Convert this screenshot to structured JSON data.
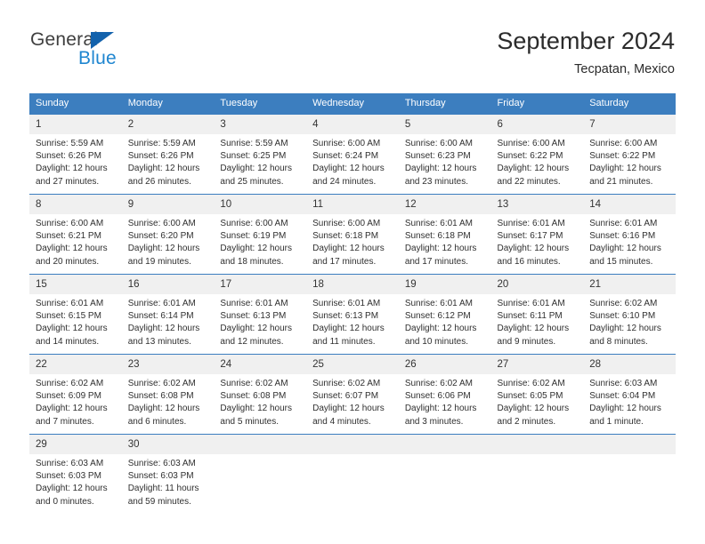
{
  "brand": {
    "name_top": "General",
    "name_bottom": "Blue",
    "accent_color": "#1f86d0",
    "triangle_color": "#1362ac"
  },
  "header": {
    "title": "September 2024",
    "subtitle": "Tecpatan, Mexico"
  },
  "theme": {
    "header_row_bg": "#3c7ebf",
    "daynum_bg": "#f0f0f0",
    "text_color": "#2f2f2f"
  },
  "weekday_headers": [
    "Sunday",
    "Monday",
    "Tuesday",
    "Wednesday",
    "Thursday",
    "Friday",
    "Saturday"
  ],
  "weeks": [
    [
      {
        "day": "1",
        "sunrise": "Sunrise: 5:59 AM",
        "sunset": "Sunset: 6:26 PM",
        "daylight_line1": "Daylight: 12 hours",
        "daylight_line2": "and 27 minutes."
      },
      {
        "day": "2",
        "sunrise": "Sunrise: 5:59 AM",
        "sunset": "Sunset: 6:26 PM",
        "daylight_line1": "Daylight: 12 hours",
        "daylight_line2": "and 26 minutes."
      },
      {
        "day": "3",
        "sunrise": "Sunrise: 5:59 AM",
        "sunset": "Sunset: 6:25 PM",
        "daylight_line1": "Daylight: 12 hours",
        "daylight_line2": "and 25 minutes."
      },
      {
        "day": "4",
        "sunrise": "Sunrise: 6:00 AM",
        "sunset": "Sunset: 6:24 PM",
        "daylight_line1": "Daylight: 12 hours",
        "daylight_line2": "and 24 minutes."
      },
      {
        "day": "5",
        "sunrise": "Sunrise: 6:00 AM",
        "sunset": "Sunset: 6:23 PM",
        "daylight_line1": "Daylight: 12 hours",
        "daylight_line2": "and 23 minutes."
      },
      {
        "day": "6",
        "sunrise": "Sunrise: 6:00 AM",
        "sunset": "Sunset: 6:22 PM",
        "daylight_line1": "Daylight: 12 hours",
        "daylight_line2": "and 22 minutes."
      },
      {
        "day": "7",
        "sunrise": "Sunrise: 6:00 AM",
        "sunset": "Sunset: 6:22 PM",
        "daylight_line1": "Daylight: 12 hours",
        "daylight_line2": "and 21 minutes."
      }
    ],
    [
      {
        "day": "8",
        "sunrise": "Sunrise: 6:00 AM",
        "sunset": "Sunset: 6:21 PM",
        "daylight_line1": "Daylight: 12 hours",
        "daylight_line2": "and 20 minutes."
      },
      {
        "day": "9",
        "sunrise": "Sunrise: 6:00 AM",
        "sunset": "Sunset: 6:20 PM",
        "daylight_line1": "Daylight: 12 hours",
        "daylight_line2": "and 19 minutes."
      },
      {
        "day": "10",
        "sunrise": "Sunrise: 6:00 AM",
        "sunset": "Sunset: 6:19 PM",
        "daylight_line1": "Daylight: 12 hours",
        "daylight_line2": "and 18 minutes."
      },
      {
        "day": "11",
        "sunrise": "Sunrise: 6:00 AM",
        "sunset": "Sunset: 6:18 PM",
        "daylight_line1": "Daylight: 12 hours",
        "daylight_line2": "and 17 minutes."
      },
      {
        "day": "12",
        "sunrise": "Sunrise: 6:01 AM",
        "sunset": "Sunset: 6:18 PM",
        "daylight_line1": "Daylight: 12 hours",
        "daylight_line2": "and 17 minutes."
      },
      {
        "day": "13",
        "sunrise": "Sunrise: 6:01 AM",
        "sunset": "Sunset: 6:17 PM",
        "daylight_line1": "Daylight: 12 hours",
        "daylight_line2": "and 16 minutes."
      },
      {
        "day": "14",
        "sunrise": "Sunrise: 6:01 AM",
        "sunset": "Sunset: 6:16 PM",
        "daylight_line1": "Daylight: 12 hours",
        "daylight_line2": "and 15 minutes."
      }
    ],
    [
      {
        "day": "15",
        "sunrise": "Sunrise: 6:01 AM",
        "sunset": "Sunset: 6:15 PM",
        "daylight_line1": "Daylight: 12 hours",
        "daylight_line2": "and 14 minutes."
      },
      {
        "day": "16",
        "sunrise": "Sunrise: 6:01 AM",
        "sunset": "Sunset: 6:14 PM",
        "daylight_line1": "Daylight: 12 hours",
        "daylight_line2": "and 13 minutes."
      },
      {
        "day": "17",
        "sunrise": "Sunrise: 6:01 AM",
        "sunset": "Sunset: 6:13 PM",
        "daylight_line1": "Daylight: 12 hours",
        "daylight_line2": "and 12 minutes."
      },
      {
        "day": "18",
        "sunrise": "Sunrise: 6:01 AM",
        "sunset": "Sunset: 6:13 PM",
        "daylight_line1": "Daylight: 12 hours",
        "daylight_line2": "and 11 minutes."
      },
      {
        "day": "19",
        "sunrise": "Sunrise: 6:01 AM",
        "sunset": "Sunset: 6:12 PM",
        "daylight_line1": "Daylight: 12 hours",
        "daylight_line2": "and 10 minutes."
      },
      {
        "day": "20",
        "sunrise": "Sunrise: 6:01 AM",
        "sunset": "Sunset: 6:11 PM",
        "daylight_line1": "Daylight: 12 hours",
        "daylight_line2": "and 9 minutes."
      },
      {
        "day": "21",
        "sunrise": "Sunrise: 6:02 AM",
        "sunset": "Sunset: 6:10 PM",
        "daylight_line1": "Daylight: 12 hours",
        "daylight_line2": "and 8 minutes."
      }
    ],
    [
      {
        "day": "22",
        "sunrise": "Sunrise: 6:02 AM",
        "sunset": "Sunset: 6:09 PM",
        "daylight_line1": "Daylight: 12 hours",
        "daylight_line2": "and 7 minutes."
      },
      {
        "day": "23",
        "sunrise": "Sunrise: 6:02 AM",
        "sunset": "Sunset: 6:08 PM",
        "daylight_line1": "Daylight: 12 hours",
        "daylight_line2": "and 6 minutes."
      },
      {
        "day": "24",
        "sunrise": "Sunrise: 6:02 AM",
        "sunset": "Sunset: 6:08 PM",
        "daylight_line1": "Daylight: 12 hours",
        "daylight_line2": "and 5 minutes."
      },
      {
        "day": "25",
        "sunrise": "Sunrise: 6:02 AM",
        "sunset": "Sunset: 6:07 PM",
        "daylight_line1": "Daylight: 12 hours",
        "daylight_line2": "and 4 minutes."
      },
      {
        "day": "26",
        "sunrise": "Sunrise: 6:02 AM",
        "sunset": "Sunset: 6:06 PM",
        "daylight_line1": "Daylight: 12 hours",
        "daylight_line2": "and 3 minutes."
      },
      {
        "day": "27",
        "sunrise": "Sunrise: 6:02 AM",
        "sunset": "Sunset: 6:05 PM",
        "daylight_line1": "Daylight: 12 hours",
        "daylight_line2": "and 2 minutes."
      },
      {
        "day": "28",
        "sunrise": "Sunrise: 6:03 AM",
        "sunset": "Sunset: 6:04 PM",
        "daylight_line1": "Daylight: 12 hours",
        "daylight_line2": "and 1 minute."
      }
    ],
    [
      {
        "day": "29",
        "sunrise": "Sunrise: 6:03 AM",
        "sunset": "Sunset: 6:03 PM",
        "daylight_line1": "Daylight: 12 hours",
        "daylight_line2": "and 0 minutes."
      },
      {
        "day": "30",
        "sunrise": "Sunrise: 6:03 AM",
        "sunset": "Sunset: 6:03 PM",
        "daylight_line1": "Daylight: 11 hours",
        "daylight_line2": "and 59 minutes."
      },
      {
        "day": "",
        "sunrise": "",
        "sunset": "",
        "daylight_line1": "",
        "daylight_line2": ""
      },
      {
        "day": "",
        "sunrise": "",
        "sunset": "",
        "daylight_line1": "",
        "daylight_line2": ""
      },
      {
        "day": "",
        "sunrise": "",
        "sunset": "",
        "daylight_line1": "",
        "daylight_line2": ""
      },
      {
        "day": "",
        "sunrise": "",
        "sunset": "",
        "daylight_line1": "",
        "daylight_line2": ""
      },
      {
        "day": "",
        "sunrise": "",
        "sunset": "",
        "daylight_line1": "",
        "daylight_line2": ""
      }
    ]
  ]
}
